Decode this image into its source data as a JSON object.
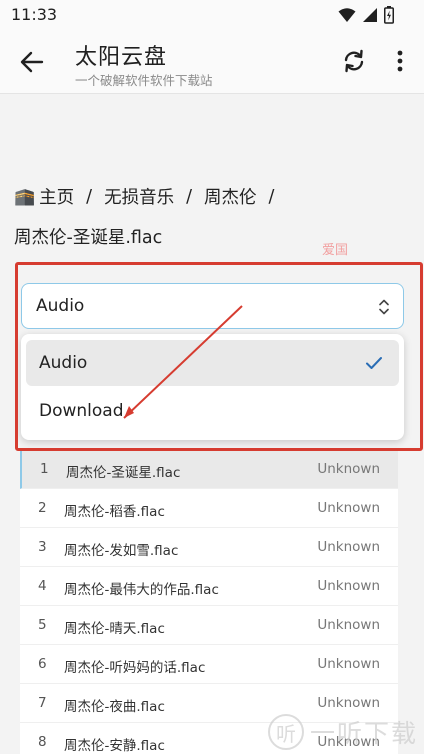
{
  "status_bar": {
    "time": "11:33",
    "icons": [
      "wifi-icon",
      "signal-icon",
      "battery-icon"
    ]
  },
  "app_bar": {
    "title": "太阳云盘",
    "subtitle": "一个破解软件软件下载站",
    "icons": [
      "back-arrow-icon",
      "refresh-icon",
      "more-vert-icon"
    ]
  },
  "breadcrumb": {
    "items": [
      "主页",
      "无损音乐",
      "周杰伦"
    ],
    "separator": "/"
  },
  "file": {
    "title": "周杰伦-圣诞星.flac"
  },
  "watermark_red": "爱国",
  "select": {
    "value": "Audio",
    "options": [
      {
        "label": "Audio",
        "selected": true
      },
      {
        "label": "Download",
        "selected": false
      }
    ]
  },
  "playlist": [
    {
      "index": "1",
      "name": "周杰伦-圣诞星.flac",
      "meta": "Unknown"
    },
    {
      "index": "2",
      "name": "周杰伦-稻香.flac",
      "meta": "Unknown"
    },
    {
      "index": "3",
      "name": "周杰伦-发如雪.flac",
      "meta": "Unknown"
    },
    {
      "index": "4",
      "name": "周杰伦-最伟大的作品.flac",
      "meta": "Unknown"
    },
    {
      "index": "5",
      "name": "周杰伦-晴天.flac",
      "meta": "Unknown"
    },
    {
      "index": "6",
      "name": "周杰伦-听妈妈的话.flac",
      "meta": "Unknown"
    },
    {
      "index": "7",
      "name": "周杰伦-夜曲.flac",
      "meta": "Unknown"
    },
    {
      "index": "8",
      "name": "周杰伦-安静.flac",
      "meta": "Unknown"
    }
  ],
  "brand_watermark": {
    "badge": "听",
    "text": "一听下载"
  },
  "colors": {
    "highlight_red": "#d63c30",
    "accent_blue": "#8ec9e8",
    "check_blue": "#2a6db5"
  }
}
